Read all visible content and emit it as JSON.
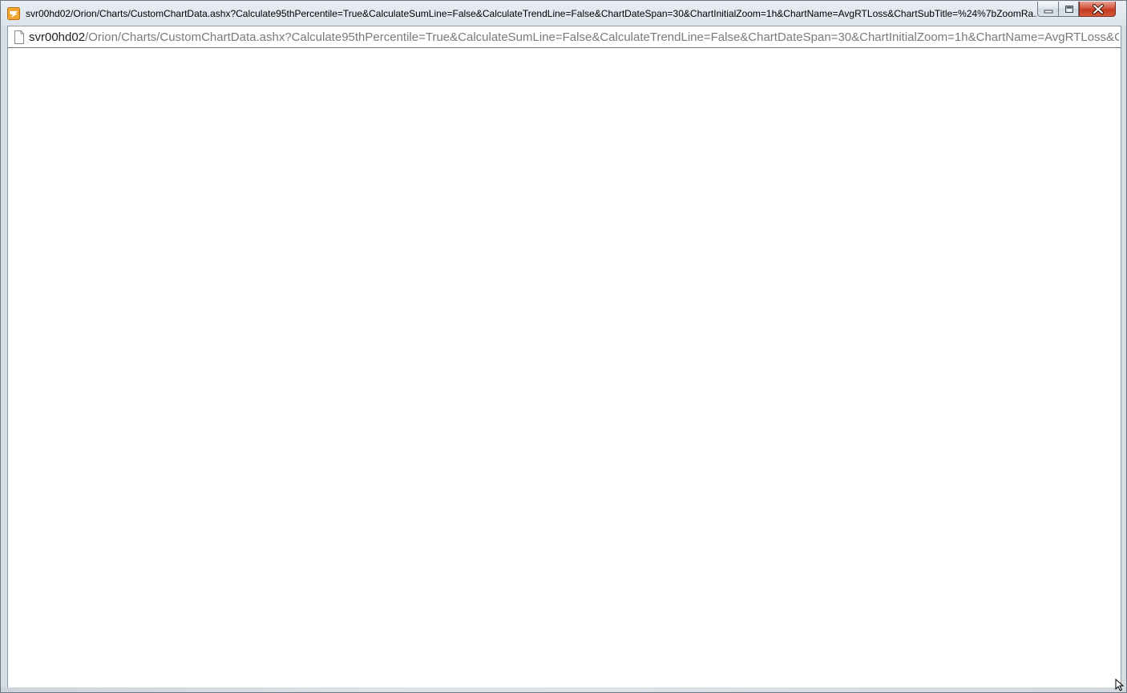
{
  "window": {
    "title": "svr00hd02/Orion/Charts/CustomChartData.ashx?Calculate95thPercentile=True&CalculateSumLine=False&CalculateTrendLine=False&ChartDateSpan=30&ChartInitialZoom=1h&ChartName=AvgRTLoss&ChartSubTitle=%24%7bZoomRa...",
    "app_icon": "orion-app-icon",
    "buttons": {
      "minimize_icon": "minimize-icon",
      "maximize_icon": "maximize-icon",
      "close_icon": "close-icon"
    }
  },
  "address_bar": {
    "page_icon": "page-icon",
    "host": "svr00hd02",
    "path": "/Orion/Charts/CustomChartData.ashx?Calculate95thPercentile=True&CalculateSumLine=False&CalculateTrendLine=False&ChartDateSpan=30&ChartInitialZoom=1h&ChartName=AvgRTLoss&ChartSubTitle=%24%7bZoomRa"
  },
  "colors": {
    "close_button": "#c23a1e",
    "frame": "#dce3eb",
    "content_background": "#ffffff"
  }
}
